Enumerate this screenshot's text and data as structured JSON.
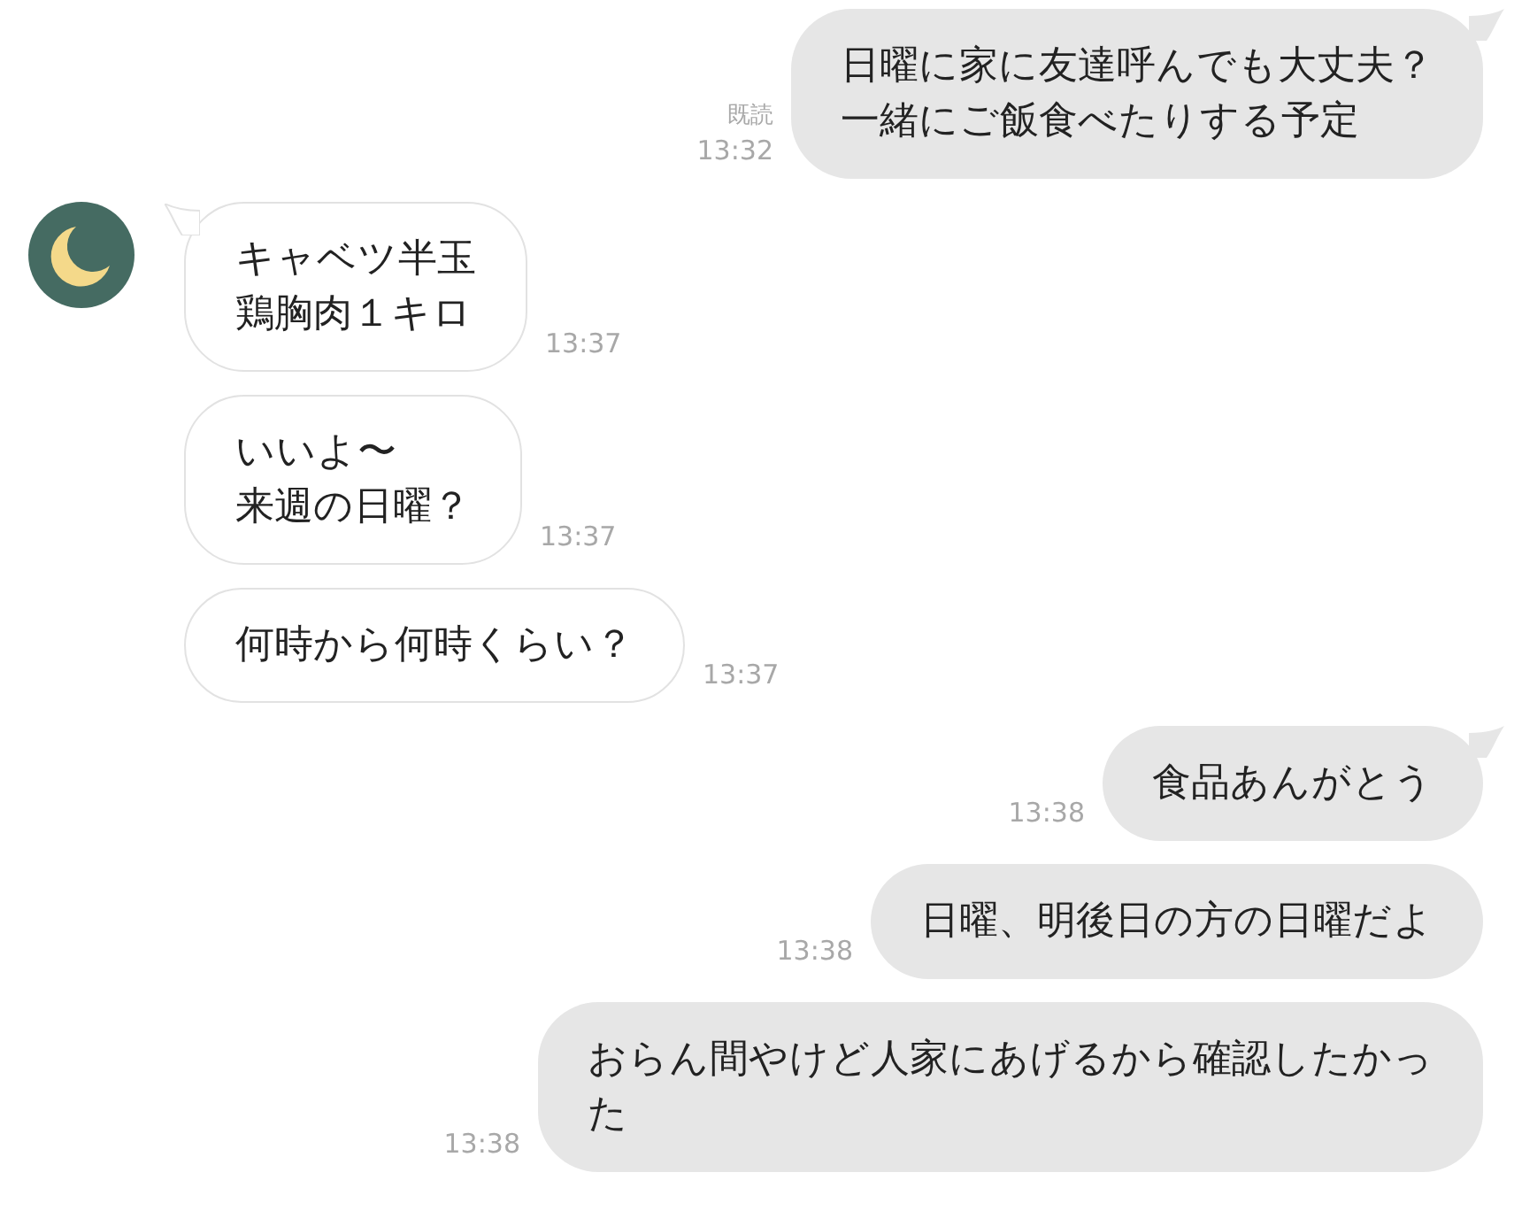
{
  "messages": [
    {
      "kind": "out",
      "tail": true,
      "lines": [
        "日曜に家に友達呼んでも大丈夫？",
        "一緒にご飯食べたりする予定"
      ],
      "read": "既読",
      "time": "13:32"
    },
    {
      "kind": "in",
      "tail": true,
      "avatar": true,
      "lines": [
        "キャベツ半玉",
        "鶏胸肉１キロ"
      ],
      "time": "13:37"
    },
    {
      "kind": "in",
      "tail": false,
      "avatar": false,
      "lines": [
        "いいよ〜",
        "来週の日曜？"
      ],
      "time": "13:37"
    },
    {
      "kind": "in",
      "tail": false,
      "avatar": false,
      "lines": [
        "何時から何時くらい？"
      ],
      "time": "13:37"
    },
    {
      "kind": "out",
      "tail": true,
      "lines": [
        "食品あんがとう"
      ],
      "time": "13:38"
    },
    {
      "kind": "out",
      "tail": false,
      "lines": [
        "日曜、明後日の方の日曜だよ"
      ],
      "time": "13:38"
    },
    {
      "kind": "out",
      "tail": false,
      "lines": [
        "おらん間やけど人家にあげるから確認したかっ",
        "た"
      ],
      "time": "13:38"
    }
  ]
}
